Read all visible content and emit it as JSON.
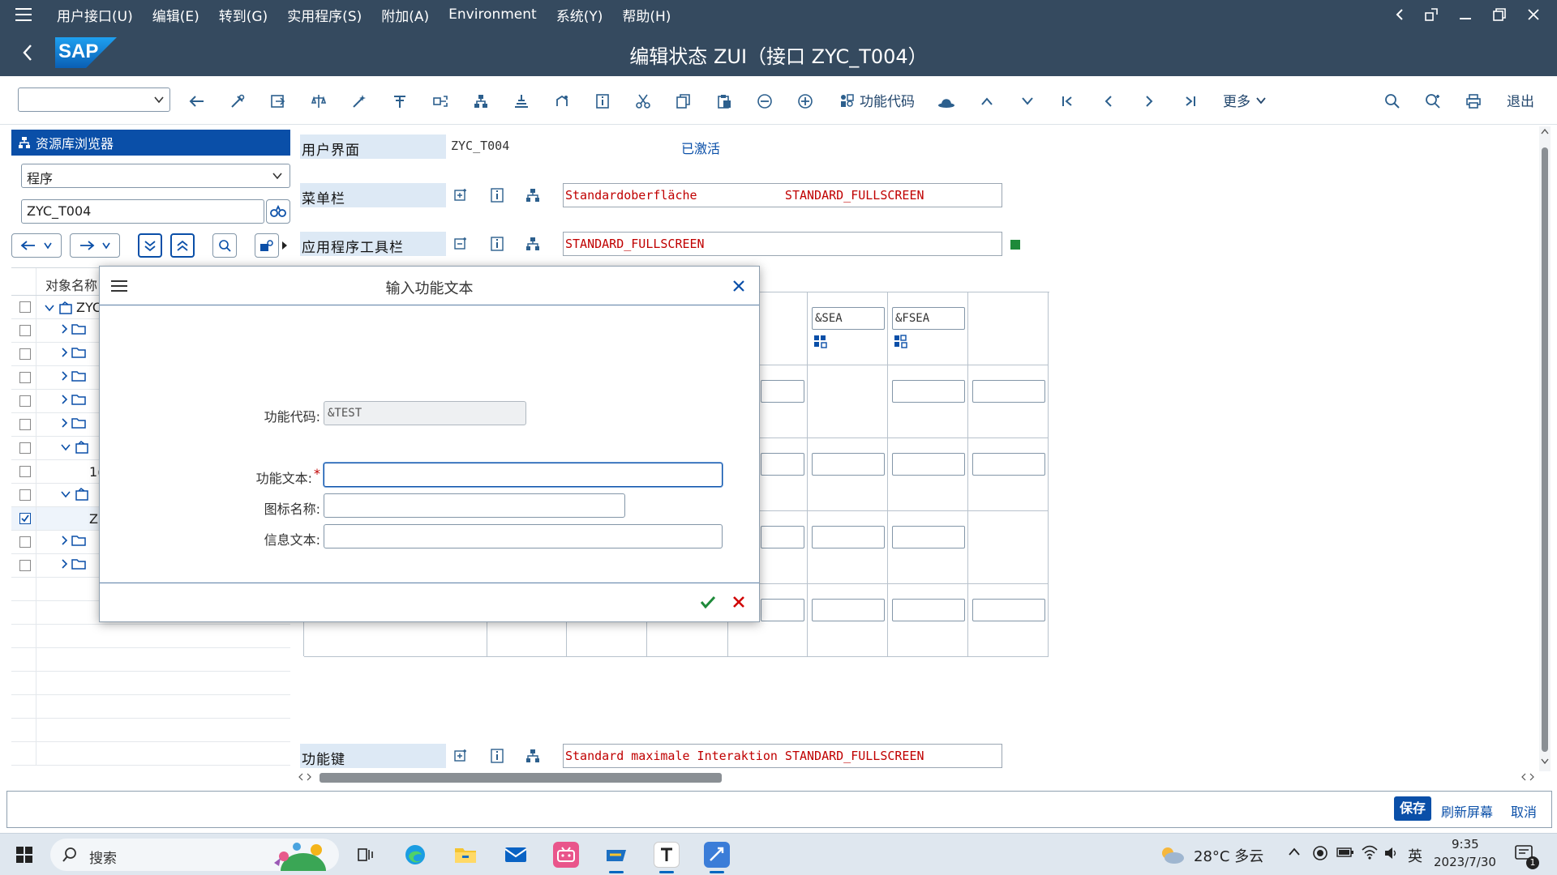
{
  "menubar": {
    "items": [
      "用户接口(U)",
      "编辑(E)",
      "转到(G)",
      "实用程序(S)",
      "附加(A)",
      "Environment",
      "系统(Y)",
      "帮助(H)"
    ]
  },
  "titlebar": {
    "title": "编辑状态 ZUI（接口 ZYC_T004）",
    "logo_text": "SAP"
  },
  "toolbar": {
    "command_field_value": "",
    "function_code_label": "功能代码",
    "more_label": "更多",
    "exit_label": "退出"
  },
  "left_panel": {
    "header": "资源库浏览器",
    "object_type": "程序",
    "object_name": "ZYC_T004",
    "column_header": "对象名称",
    "rows": [
      {
        "text": "ZYC",
        "checked": false
      },
      {
        "text": "",
        "checked": false
      },
      {
        "text": "",
        "checked": false
      },
      {
        "text": "",
        "checked": false
      },
      {
        "text": "",
        "checked": false
      },
      {
        "text": "",
        "checked": false
      },
      {
        "text": "",
        "checked": false
      },
      {
        "text": "1(",
        "checked": false
      },
      {
        "text": "",
        "checked": false
      },
      {
        "text": "Z",
        "checked": true
      },
      {
        "text": "",
        "checked": false
      },
      {
        "text": "",
        "checked": false
      }
    ]
  },
  "main": {
    "ui_label": "用户界面",
    "ui_value": "ZYC_T004",
    "ui_status": "已激活",
    "menubar_label": "菜单栏",
    "menubar_value": "Standardoberfläche            STANDARD_FULLSCREEN",
    "apptoolbar_label": "应用程序工具栏",
    "apptoolbar_value": "STANDARD_FULLSCREEN",
    "fkeys_label": "功能键",
    "fkeys_value": "Standard maximale Interaktion STANDARD_FULLSCREEN",
    "grid": {
      "header_cells": [
        "&SEA",
        "&FSEA"
      ]
    }
  },
  "dialog": {
    "title": "输入功能文本",
    "function_code_label": "功能代码:",
    "function_code_value": "&TEST",
    "function_text_label": "功能文本:",
    "function_text_value": "",
    "required_mark": "*",
    "icon_name_label": "图标名称:",
    "icon_name_value": "",
    "info_text_label": "信息文本:",
    "info_text_value": ""
  },
  "statusbar": {
    "save": "保存",
    "refresh": "刷新屏幕",
    "cancel": "取消"
  },
  "taskbar": {
    "search_placeholder": "搜索",
    "weather": "28°C 多云",
    "ime": "英",
    "time": "9:35",
    "date": "2023/7/30",
    "notification_count": "1"
  },
  "colors": {
    "shell": "#354a5f",
    "accent": "#0a4fa8",
    "value_red": "#c00000",
    "label_bg": "#dde9f5"
  }
}
